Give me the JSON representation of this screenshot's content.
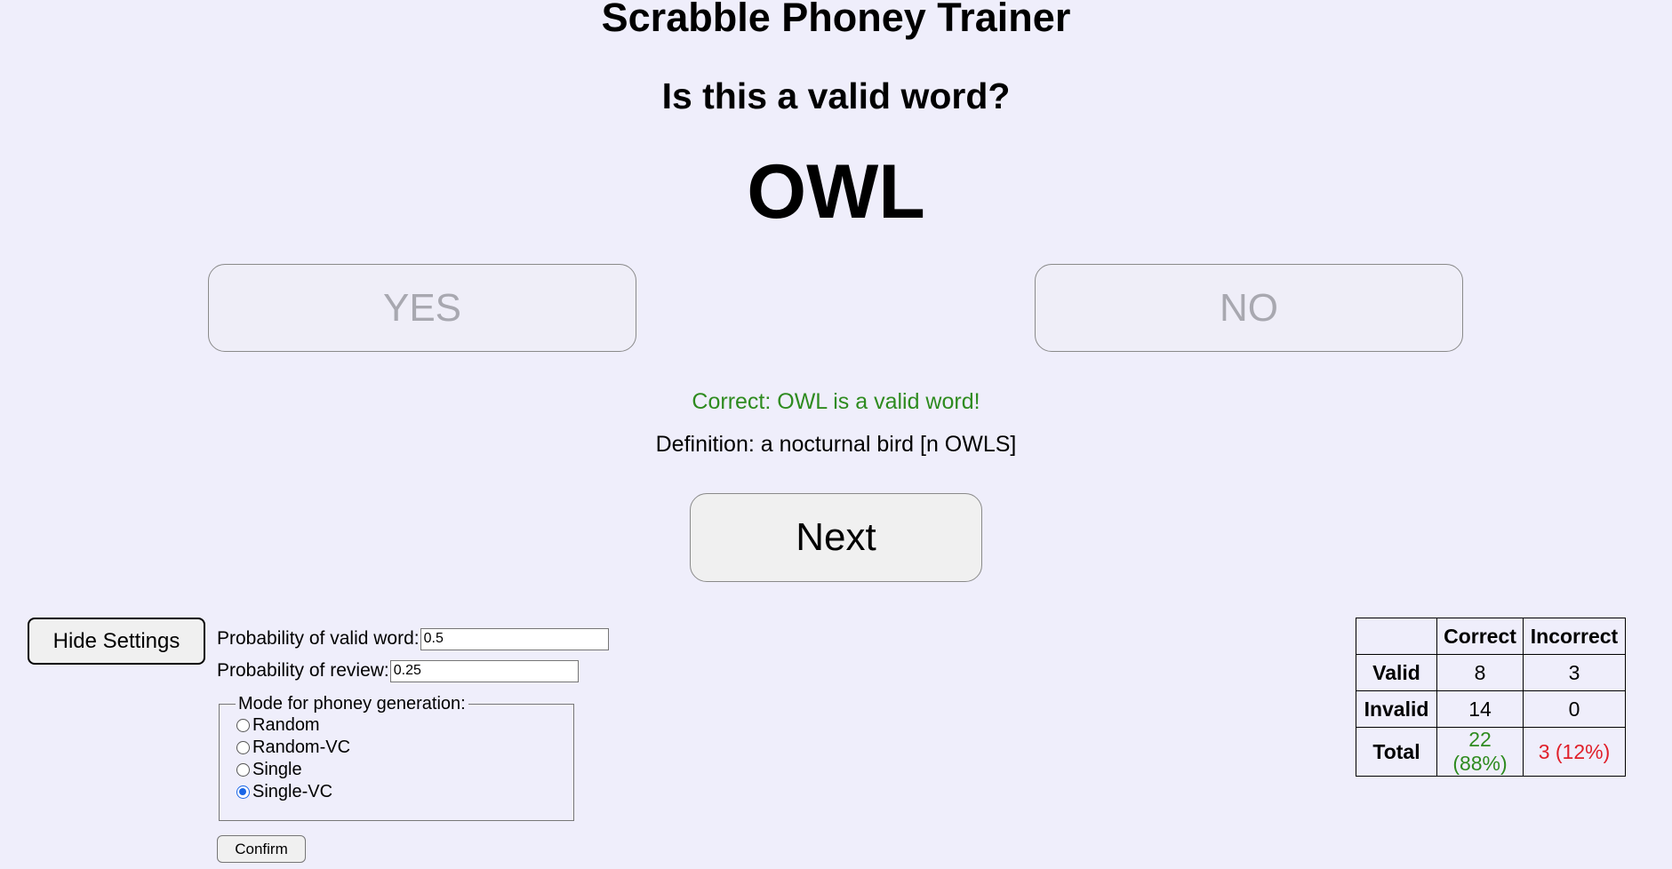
{
  "app": {
    "title": "Scrabble Phoney Trainer",
    "question": "Is this a valid word?",
    "word": "OWL"
  },
  "buttons": {
    "yes": "YES",
    "no": "NO",
    "next": "Next",
    "hide_settings": "Hide Settings",
    "confirm": "Confirm"
  },
  "feedback": {
    "result": "Correct: OWL is a valid word!",
    "definition": "Definition: a nocturnal bird [n OWLS]"
  },
  "settings": {
    "prob_valid_label": "Probability of valid word:",
    "prob_valid_value": "0.5",
    "prob_review_label": "Probability of review:",
    "prob_review_value": "0.25",
    "mode_legend": "Mode for phoney generation:",
    "modes": [
      "Random",
      "Random-VC",
      "Single",
      "Single-VC"
    ],
    "selected_mode": "Single-VC"
  },
  "stats": {
    "headers": [
      "",
      "Correct",
      "Incorrect"
    ],
    "rows": [
      {
        "label": "Valid",
        "correct": "8",
        "incorrect": "3"
      },
      {
        "label": "Invalid",
        "correct": "14",
        "incorrect": "0"
      },
      {
        "label": "Total",
        "correct": "22 (88%)",
        "incorrect": "3 (12%)"
      }
    ]
  },
  "colors": {
    "background": "#efeefb",
    "correct": "#2e8b1f",
    "incorrect": "#e0202a",
    "radio_accent": "#1a66e6"
  }
}
